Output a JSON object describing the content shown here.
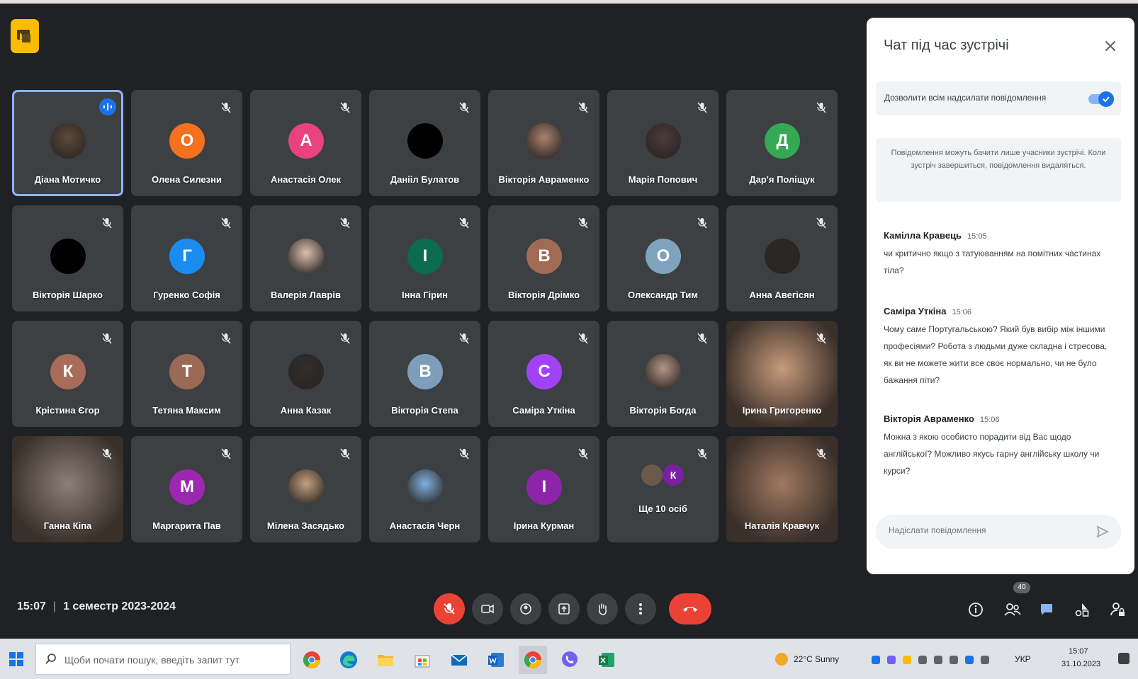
{
  "colors": {
    "background": "#202124",
    "tile": "#3c4043",
    "accent": "#1a73e8",
    "danger": "#ea4335",
    "logo": "#fbbc04"
  },
  "participants": [
    {
      "name": "Діана Мотичко",
      "initial": "",
      "color": "#5d4a3c",
      "photo": true,
      "speaking": true
    },
    {
      "name": "Олена Силезни",
      "initial": "О",
      "color": "#f4711d"
    },
    {
      "name": "Анастасія Олек",
      "initial": "А",
      "color": "#e8437c"
    },
    {
      "name": "Данііл Булатов",
      "initial": "",
      "color": "#000000"
    },
    {
      "name": "Вікторія Авраменко",
      "initial": "",
      "color": "#a98270",
      "photo": true
    },
    {
      "name": "Марія Попович",
      "initial": "",
      "color": "#4a3b3a",
      "photo": true
    },
    {
      "name": "Дар'я Поліщук",
      "initial": "Д",
      "color": "#34a853"
    },
    {
      "name": "Вікторія Шарко",
      "initial": "",
      "color": "#000000"
    },
    {
      "name": "Гуренко Софія",
      "initial": "Г",
      "color": "#1a8cf0"
    },
    {
      "name": "Валерія Лаврів",
      "initial": "",
      "color": "#d9c0b0",
      "photo": true
    },
    {
      "name": "Інна Гірин",
      "initial": "І",
      "color": "#0b6b4e"
    },
    {
      "name": "Вікторія Дрімко",
      "initial": "В",
      "color": "#a16a55"
    },
    {
      "name": "Олександр Тим",
      "initial": "О",
      "color": "#7fa3bd"
    },
    {
      "name": "Анна Авегісян",
      "initial": "",
      "color": "#2a2a2a",
      "photo": true
    },
    {
      "name": "Крістина Єгор",
      "initial": "К",
      "color": "#a86d5a"
    },
    {
      "name": "Тетяна Максим",
      "initial": "Т",
      "color": "#9a6a56"
    },
    {
      "name": "Анна Казак",
      "initial": "",
      "color": "#2f2f2f",
      "photo": true
    },
    {
      "name": "Вікторія Степа",
      "initial": "В",
      "color": "#7d9dbb"
    },
    {
      "name": "Саміра Уткіна",
      "initial": "С",
      "color": "#a142f4"
    },
    {
      "name": "Вікторія Богда",
      "initial": "",
      "color": "#b59686",
      "photo": true
    },
    {
      "name": "Ірина Григоренко",
      "initial": "",
      "color": "#c79a7a",
      "photo": true,
      "video": true
    },
    {
      "name": "Ганна Кіпа",
      "initial": "",
      "color": "#8a8078",
      "photo": true,
      "video": true
    },
    {
      "name": "Маргарита Пав",
      "initial": "М",
      "color": "#9c27b0"
    },
    {
      "name": "Мілена Засядько",
      "initial": "",
      "color": "#c4a080",
      "photo": true
    },
    {
      "name": "Анастасія Черн",
      "initial": "",
      "color": "#7fb0e0",
      "photo": true
    },
    {
      "name": "Ірина Курман",
      "initial": "І",
      "color": "#8e24aa"
    },
    {
      "name": "Ще 10 осіб",
      "initial": "К",
      "color": "#7b1fa2",
      "group": true
    },
    {
      "name": "Наталія Кравчук",
      "initial": "",
      "color": "#a07860",
      "photo": true,
      "video": true
    }
  ],
  "chat": {
    "title": "Чат під час зустрічі",
    "toggle_label": "Дозволити всім надсилати повідомлення",
    "info": "Повідомлення можуть бачити лише учасники зустрічі. Коли зустріч завершиться, повідомлення видаляться.",
    "messages": [
      {
        "author": "Камілла Кравець",
        "time": "15:05",
        "text": "чи критично якщо з татуюванням на помітних частинах тіла?"
      },
      {
        "author": "Саміра Уткіна",
        "time": "15:06",
        "text": "Чому саме Португальською? Який був вибір між іншими професіями? Робота з людьми дуже складна і стресова, як ви не можете жити все своє нормально, чи не було бажання піти?"
      },
      {
        "author": "Вікторія Авраменко",
        "time": "15:06",
        "text": "Можна з якою особисто порадити від Вас щодо англійської? Можливо якусь гарну англійську школу чи курси?"
      }
    ],
    "composer_placeholder": "Надіслати повідомлення"
  },
  "meeting": {
    "time": "15:07",
    "title": "1 семестр 2023-2024",
    "people_count": "40"
  },
  "taskbar": {
    "search_placeholder": "Щоби почати пошук, введіть запит тут",
    "weather": "22°C Sunny",
    "lang": "УКР",
    "clock_time": "15:07",
    "clock_date": "31.10.2023"
  }
}
